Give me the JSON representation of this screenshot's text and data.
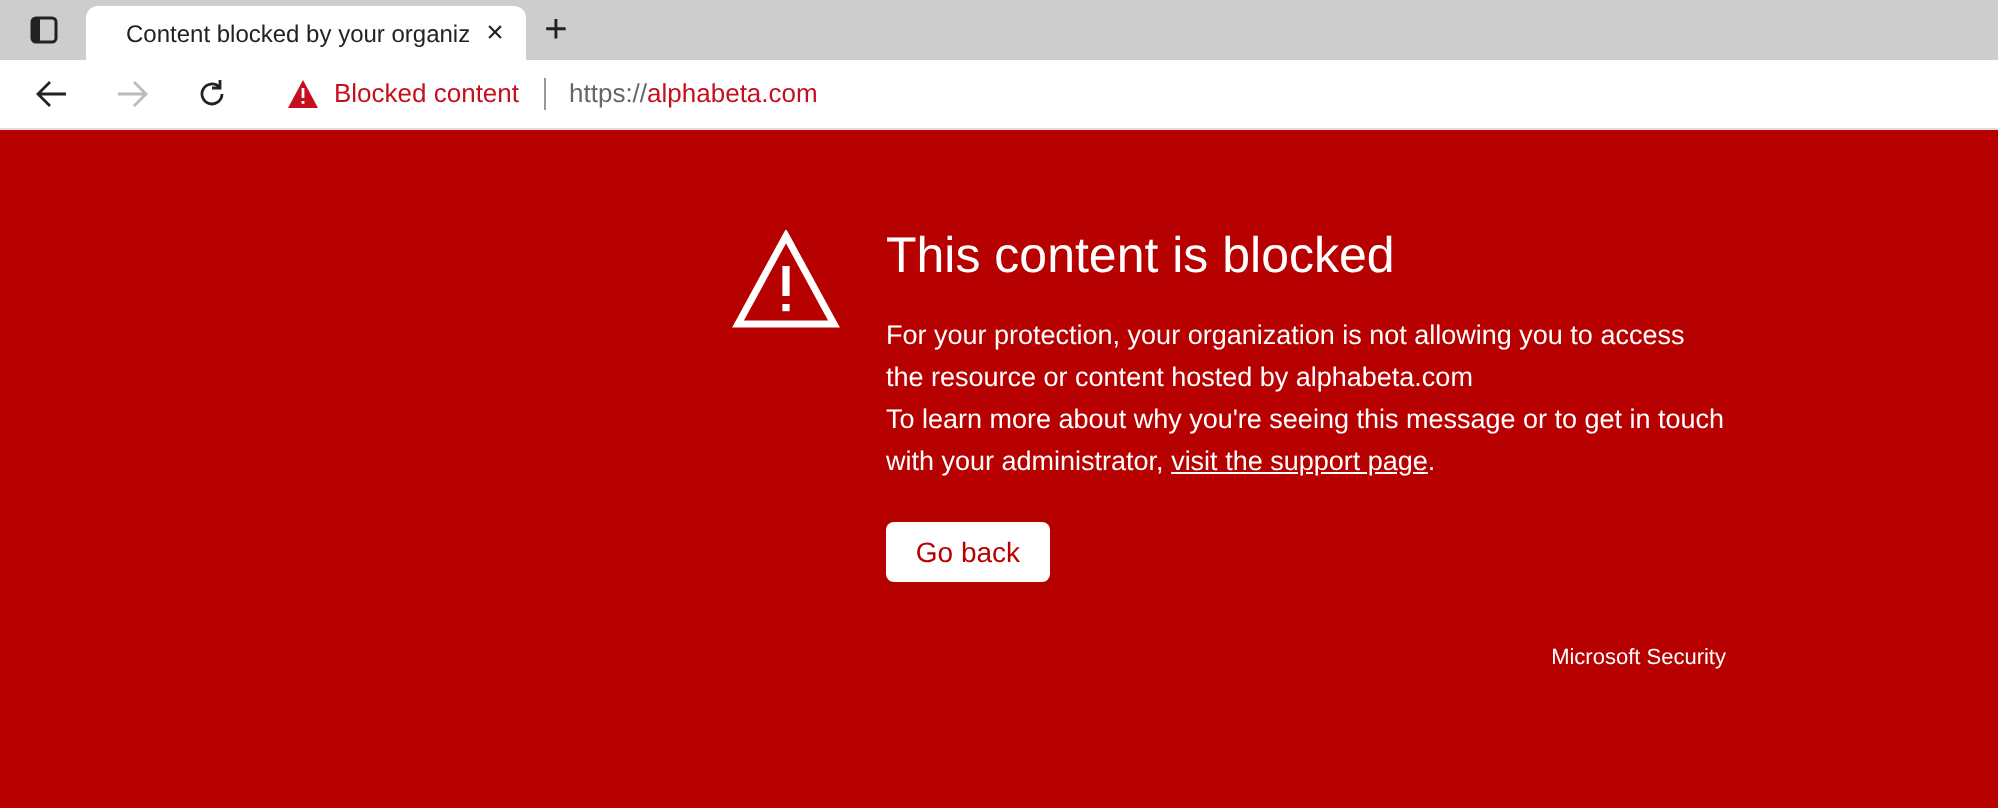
{
  "tab": {
    "title": "Content blocked by your organiz",
    "close": "×",
    "new_tab": "+"
  },
  "address_bar": {
    "status": "Blocked content",
    "url_scheme": "https://",
    "url_host": "alphabeta.com"
  },
  "page": {
    "heading": "This content is blocked",
    "paragraphs": [
      "For your protection, your organization is not allowing you to access the resource or content hosted by alphabeta.com"
    ],
    "support_text": "To learn more about why you're seeing this message or to get in touch with your administrator, ",
    "support_link": "visit the support page",
    "support_end": ".",
    "button": "Go back",
    "footer": "Microsoft Security"
  }
}
